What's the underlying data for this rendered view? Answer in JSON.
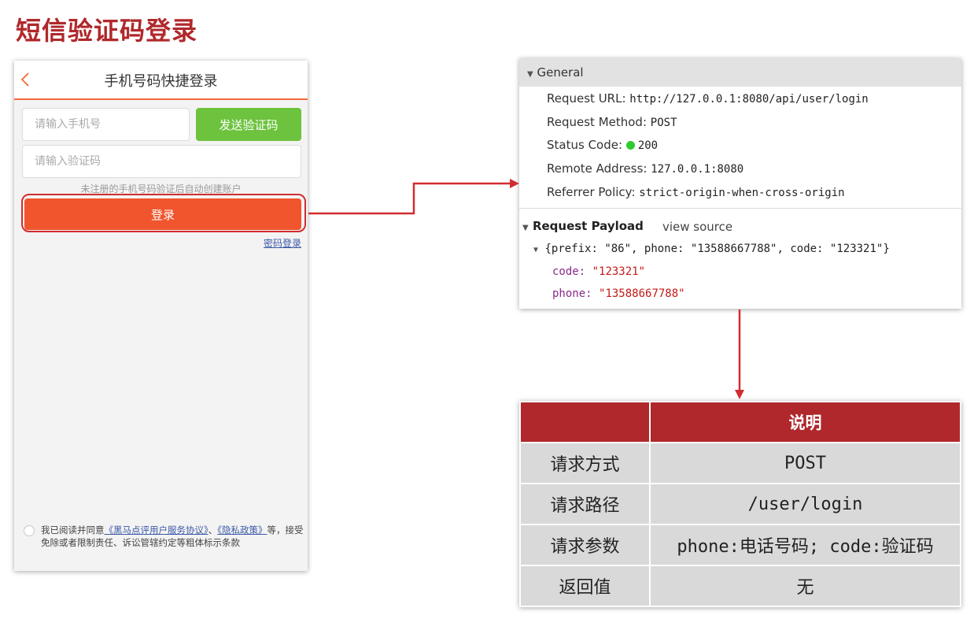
{
  "slide_title": "短信验证码登录",
  "phone": {
    "title": "手机号码快捷登录",
    "phone_placeholder": "请输入手机号",
    "send_code_label": "发送验证码",
    "code_placeholder": "请输入验证码",
    "hint": "未注册的手机号码验证后自动创建账户",
    "login_label": "登录",
    "password_login_link": "密码登录",
    "agreement": {
      "prefix": "我已阅读并同意",
      "link1": "《黑马点评用户服务协议》",
      "sep": "、",
      "link2": "《隐私政策》",
      "suffix": "等，接受免除或者限制责任、诉讼管辖约定等粗体标示条款"
    }
  },
  "devtools": {
    "general_label": "General",
    "rows": [
      {
        "key": "Request URL:",
        "value": "http://127.0.0.1:8080/api/user/login"
      },
      {
        "key": "Request Method:",
        "value": "POST"
      },
      {
        "key": "Status Code:",
        "value": "200"
      },
      {
        "key": "Remote Address:",
        "value": "127.0.0.1:8080"
      },
      {
        "key": "Referrer Policy:",
        "value": "strict-origin-when-cross-origin"
      }
    ],
    "status_color": "#2ecc2e",
    "payload_label": "Request Payload",
    "view_source_label": "view source",
    "payload_object": "{prefix: \"86\", phone: \"13588667788\", code: \"123321\"}",
    "props": [
      {
        "key": "code:",
        "value": "\"123321\""
      },
      {
        "key": "phone:",
        "value": "\"13588667788\""
      }
    ]
  },
  "table": {
    "header": [
      "",
      "说明"
    ],
    "rows": [
      {
        "label": "请求方式",
        "value": "POST"
      },
      {
        "label": "请求路径",
        "value": "/user/login"
      },
      {
        "label": "请求参数",
        "value": "phone:电话号码; code:验证码"
      },
      {
        "label": "返回值",
        "value": "无"
      }
    ]
  },
  "colors": {
    "accent": "#b0282b",
    "login_button": "#f0552d",
    "send_button": "#6dc33e",
    "arrow": "#d22d30"
  }
}
